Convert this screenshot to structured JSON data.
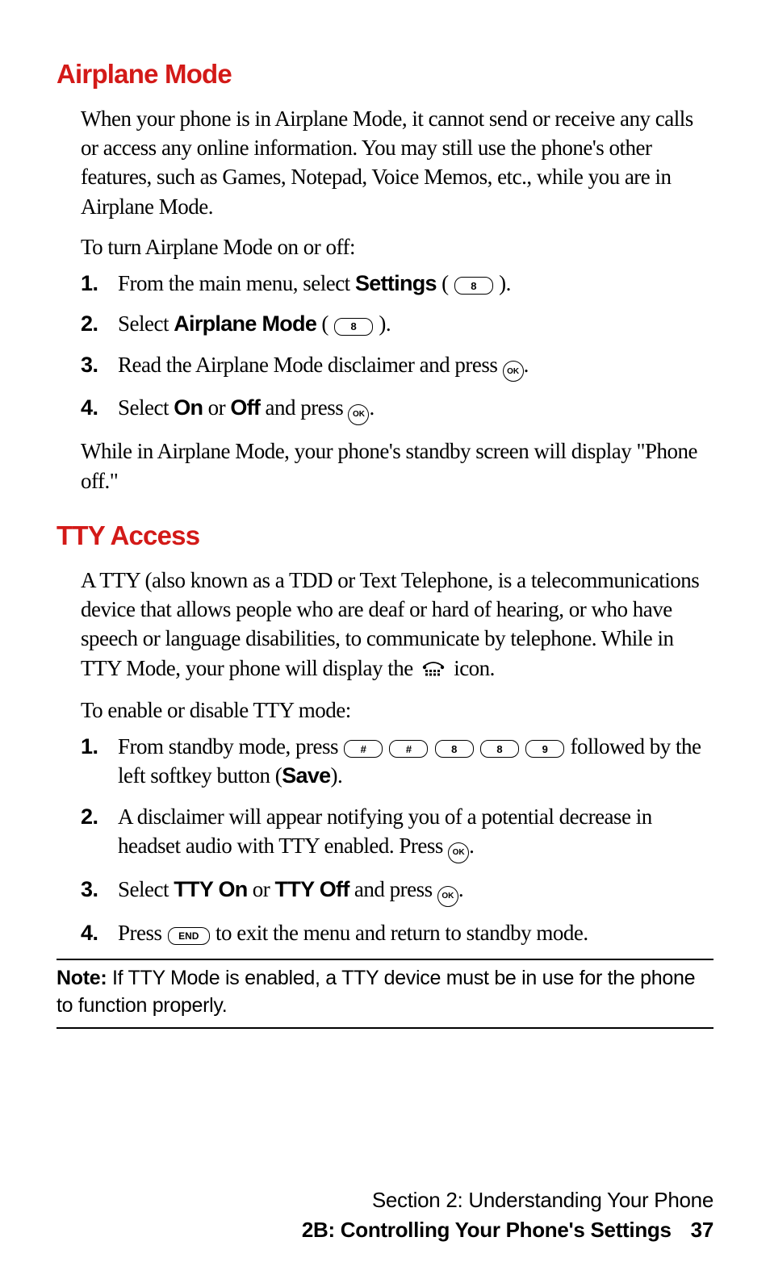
{
  "airplane": {
    "heading": "Airplane Mode",
    "p1": "When your phone is in Airplane Mode, it cannot send or receive any calls or access any online information. You may still use the phone's other features, such as Games, Notepad, Voice Memos, etc., while you are in Airplane Mode.",
    "p2": "To turn Airplane Mode on or off:",
    "steps": {
      "s1_a": "From the main menu, select ",
      "s1_b": "Settings",
      "s1_c": " ( ",
      "s1_key": "8",
      "s1_d": " ).",
      "s2_a": "Select ",
      "s2_b": "Airplane Mode",
      "s2_c": " ( ",
      "s2_key": "8",
      "s2_d": " ).",
      "s3_a": "Read the Airplane Mode disclaimer and press ",
      "s3_ok": "OK",
      "s3_b": ".",
      "s4_a": "Select ",
      "s4_b": "On",
      "s4_c": " or ",
      "s4_d": "Off",
      "s4_e": " and press ",
      "s4_ok": "OK",
      "s4_f": "."
    },
    "p3": "While in Airplane Mode, your phone's standby screen will display \"Phone off.\"",
    "nums": {
      "n1": "1.",
      "n2": "2.",
      "n3": "3.",
      "n4": "4."
    }
  },
  "tty": {
    "heading": "TTY Access",
    "p1_a": "A TTY (also known as a TDD or Text Telephone, is a telecommunications device that allows people who are deaf or hard of hearing, or who have speech or language disabilities, to communicate by telephone. While in TTY Mode, your phone will display the ",
    "p1_b": " icon.",
    "p2": "To enable or disable TTY mode:",
    "steps": {
      "s1_a": "From standby mode, press ",
      "s1_keys": [
        "#",
        "#",
        "8",
        "8",
        "9"
      ],
      "s1_b": " followed by the left softkey button (",
      "s1_c": "Save",
      "s1_d": ").",
      "s2_a": "A disclaimer will appear notifying you of a potential decrease in headset audio with TTY enabled. Press ",
      "s2_ok": "OK",
      "s2_b": ".",
      "s3_a": "Select ",
      "s3_b": "TTY On",
      "s3_c": " or ",
      "s3_d": "TTY Off",
      "s3_e": " and press ",
      "s3_ok": "OK",
      "s3_f": ".",
      "s4_a": "Press ",
      "s4_key": "END",
      "s4_b": " to exit the menu and return to standby mode."
    },
    "nums": {
      "n1": "1.",
      "n2": "2.",
      "n3": "3.",
      "n4": "4."
    }
  },
  "note": {
    "label": "Note:",
    "text": " If TTY Mode is enabled, a TTY device must be in use for the phone to function properly."
  },
  "footer": {
    "line1": "Section 2: Understanding Your Phone",
    "line2": "2B: Controlling Your Phone's Settings",
    "page": "37"
  }
}
